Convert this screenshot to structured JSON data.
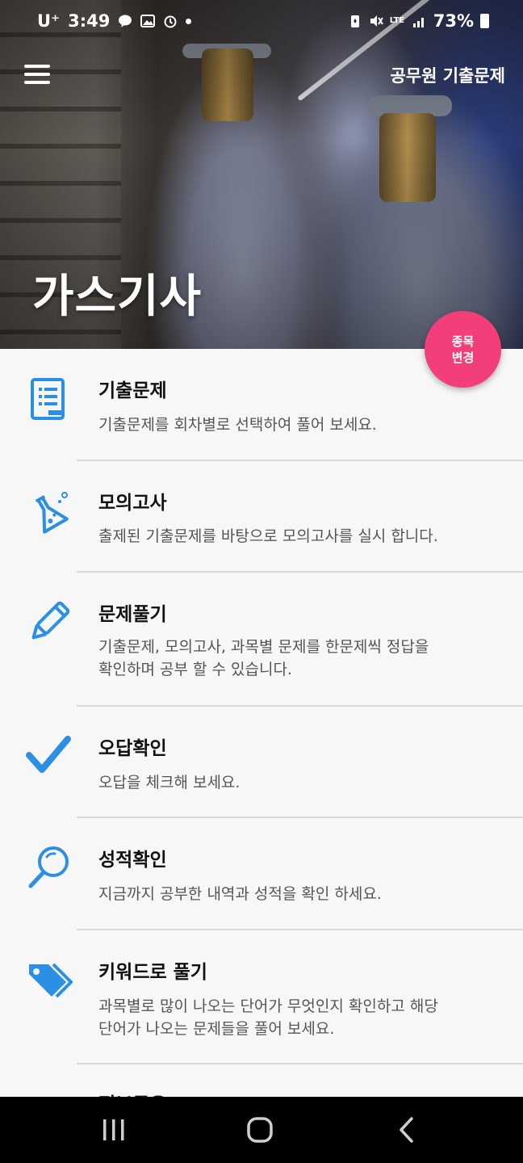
{
  "status": {
    "carrier": "U⁺",
    "time": "3:49",
    "battery": "73%",
    "network": "LTE"
  },
  "appbar": {
    "title": "공무원 기출문제"
  },
  "hero": {
    "title": "가스기사"
  },
  "fab": {
    "line1": "종목",
    "line2": "변경"
  },
  "menu": [
    {
      "title": "기출문제",
      "desc": "기출문제를 회차별로 선택하여 풀어 보세요.",
      "icon": "notebook-icon"
    },
    {
      "title": "모의고사",
      "desc": "출제된 기출문제를 바탕으로 모의고사를 실시 합니다.",
      "icon": "flask-icon"
    },
    {
      "title": "문제풀기",
      "desc_line1": "기출문제, 모의고사, 과목별 문제를 한문제씩 정답을",
      "desc_line2": "확인하며 공부 할 수 있습니다.",
      "icon": "pencil-icon"
    },
    {
      "title": "오답확인",
      "desc": "오답을 체크해 보세요.",
      "icon": "checkmark-icon"
    },
    {
      "title": "성적확인",
      "desc": "지금까지 공부한 내역과 성적을 확인 하세요.",
      "icon": "magnifier-icon"
    },
    {
      "title": "키워드로 풀기",
      "desc_line1": "과목별로 많이 나오는 단어가 무엇인지 확인하고 해당",
      "desc_line2": "단어가 나오는 문제들을 풀어 보세요.",
      "icon": "tags-icon"
    },
    {
      "title": "정보공유",
      "icon": "info-icon"
    }
  ],
  "colors": {
    "accent": "#f23f7a",
    "icon_blue": "#2b8fe6"
  }
}
